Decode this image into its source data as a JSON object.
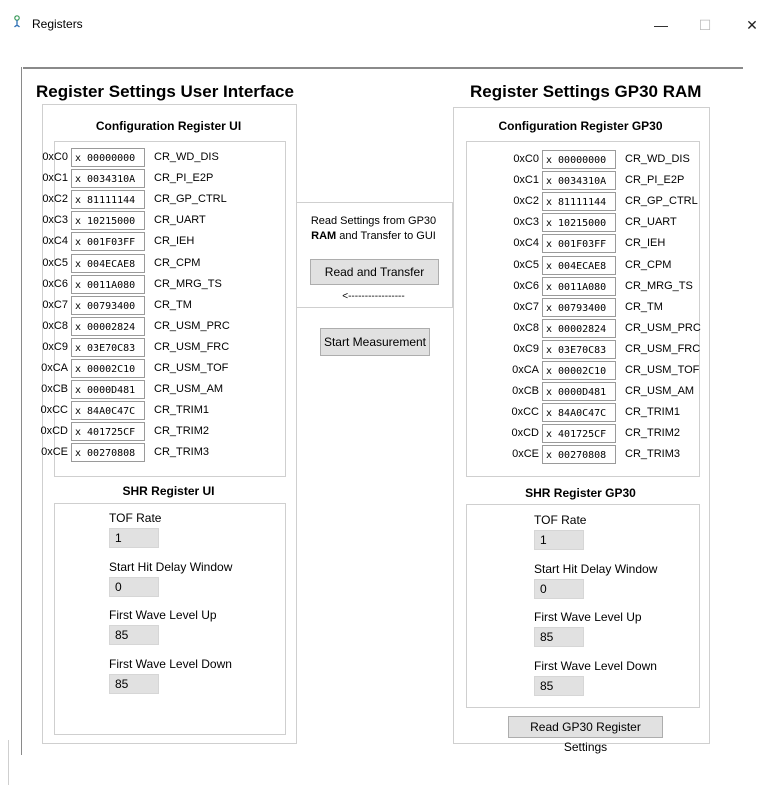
{
  "window": {
    "title": "Registers",
    "minimize": "—",
    "maximize": "☐",
    "close": "✕"
  },
  "left": {
    "heading": "Register Settings User Interface",
    "config_title": "Configuration Register UI",
    "shr_title": "SHR Register UI",
    "registers": [
      {
        "addr": "0xC0",
        "value": "x 00000000",
        "name": "CR_WD_DIS"
      },
      {
        "addr": "0xC1",
        "value": "x 0034310A",
        "name": "CR_PI_E2P"
      },
      {
        "addr": "0xC2",
        "value": "x 81111144",
        "name": "CR_GP_CTRL"
      },
      {
        "addr": "0xC3",
        "value": "x 10215000",
        "name": "CR_UART"
      },
      {
        "addr": "0xC4",
        "value": "x 001F03FF",
        "name": "CR_IEH"
      },
      {
        "addr": "0xC5",
        "value": "x 004ECAE8",
        "name": "CR_CPM"
      },
      {
        "addr": "0xC6",
        "value": "x 0011A080",
        "name": "CR_MRG_TS"
      },
      {
        "addr": "0xC7",
        "value": "x 00793400",
        "name": "CR_TM"
      },
      {
        "addr": "0xC8",
        "value": "x 00002824",
        "name": "CR_USM_PRC"
      },
      {
        "addr": "0xC9",
        "value": "x 03E70C83",
        "name": "CR_USM_FRC"
      },
      {
        "addr": "0xCA",
        "value": "x 00002C10",
        "name": "CR_USM_TOF"
      },
      {
        "addr": "0xCB",
        "value": "x 0000D481",
        "name": "CR_USM_AM"
      },
      {
        "addr": "0xCC",
        "value": "x 84A0C47C",
        "name": "CR_TRIM1"
      },
      {
        "addr": "0xCD",
        "value": "x 401725CF",
        "name": "CR_TRIM2"
      },
      {
        "addr": "0xCE",
        "value": "x 00270808",
        "name": "CR_TRIM3"
      }
    ],
    "shr": [
      {
        "label": "TOF Rate",
        "value": "1"
      },
      {
        "label": "Start Hit Delay Window",
        "value": "0"
      },
      {
        "label": "First Wave Level Up",
        "value": "85"
      },
      {
        "label": "First Wave Level Down",
        "value": "85"
      }
    ]
  },
  "middle": {
    "info_line1": "Read Settings from GP30",
    "info_bold": "RAM",
    "info_line2_rest": " and Transfer to GUI",
    "read_transfer_button": "Read and Transfer",
    "arrow": "<-----------------",
    "start_measurement_button": "Start Measurement"
  },
  "right": {
    "heading": "Register Settings GP30 RAM",
    "config_title": "Configuration Register GP30",
    "shr_title": "SHR Register GP30",
    "registers": [
      {
        "addr": "0xC0",
        "value": "x 00000000",
        "name": "CR_WD_DIS"
      },
      {
        "addr": "0xC1",
        "value": "x 0034310A",
        "name": "CR_PI_E2P"
      },
      {
        "addr": "0xC2",
        "value": "x 81111144",
        "name": "CR_GP_CTRL"
      },
      {
        "addr": "0xC3",
        "value": "x 10215000",
        "name": "CR_UART"
      },
      {
        "addr": "0xC4",
        "value": "x 001F03FF",
        "name": "CR_IEH"
      },
      {
        "addr": "0xC5",
        "value": "x 004ECAE8",
        "name": "CR_CPM"
      },
      {
        "addr": "0xC6",
        "value": "x 0011A080",
        "name": "CR_MRG_TS"
      },
      {
        "addr": "0xC7",
        "value": "x 00793400",
        "name": "CR_TM"
      },
      {
        "addr": "0xC8",
        "value": "x 00002824",
        "name": "CR_USM_PRC"
      },
      {
        "addr": "0xC9",
        "value": "x 03E70C83",
        "name": "CR_USM_FRC"
      },
      {
        "addr": "0xCA",
        "value": "x 00002C10",
        "name": "CR_USM_TOF"
      },
      {
        "addr": "0xCB",
        "value": "x 0000D481",
        "name": "CR_USM_AM"
      },
      {
        "addr": "0xCC",
        "value": "x 84A0C47C",
        "name": "CR_TRIM1"
      },
      {
        "addr": "0xCD",
        "value": "x 401725CF",
        "name": "CR_TRIM2"
      },
      {
        "addr": "0xCE",
        "value": "x 00270808",
        "name": "CR_TRIM3"
      }
    ],
    "shr": [
      {
        "label": "TOF Rate",
        "value": "1"
      },
      {
        "label": "Start Hit Delay Window",
        "value": "0"
      },
      {
        "label": "First Wave Level Up",
        "value": "85"
      },
      {
        "label": "First Wave Level Down",
        "value": "85"
      }
    ],
    "read_register_button": "Read GP30 Register Settings"
  }
}
